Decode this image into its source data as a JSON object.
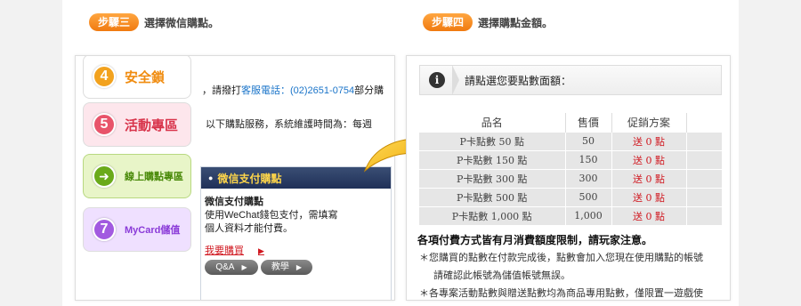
{
  "step3": {
    "badge": "步驟三",
    "text": "選擇微信購點。"
  },
  "step4": {
    "badge": "步驟四",
    "text": "選擇購點金額。"
  },
  "left_menu": [
    {
      "number": "4",
      "label": "安全鎖",
      "color": "#f08c10",
      "circle": "#f2a21e",
      "bg": "#fff"
    },
    {
      "number": "5",
      "label": "活動專區",
      "color": "#d8334a",
      "circle": "#e8546a",
      "bg": "#fde6ec"
    },
    {
      "number": "",
      "label": "線上購點專區",
      "color": "#4a8a0a",
      "circle": "#6aaa1a",
      "bg": "#e8f5c8"
    },
    {
      "number": "7",
      "label": "MyCard儲值",
      "color": "#8a3ad8",
      "circle": "#a25ae0",
      "bg": "#efe0ff"
    }
  ],
  "notice": {
    "line1_prefix": "，請撥打",
    "line1_link": "客服電話：",
    "line1_phone": "(02)2651-0754",
    "line1_suffix": "部分購",
    "line2": "以下購點服務，系統維護時間為：每週"
  },
  "wechat": {
    "header": "微信支付購點",
    "title": "微信支付購點",
    "desc1": "使用WeChat錢包支付，需填寫",
    "desc2": "個人資料才能付費。",
    "buy_link": "我要購買",
    "qa": "Q&A",
    "tutorial": "教學"
  },
  "info_bar": "請點選您要點數面額：",
  "table": {
    "headers": [
      "品名",
      "售價",
      "促銷方案"
    ],
    "rows": [
      [
        "P卡點數 50 點",
        "50",
        "送 0 點"
      ],
      [
        "P卡點數 150 點",
        "150",
        "送 0 點"
      ],
      [
        "P卡點數 300 點",
        "300",
        "送 0 點"
      ],
      [
        "P卡點數 500 點",
        "500",
        "送 0 點"
      ],
      [
        "P卡點數 1,000 點",
        "1,000",
        "送 0 點"
      ]
    ]
  },
  "rules": {
    "title": "各項付費方式皆有月消費額度限制，請玩家注意。",
    "line1": "＊您購買的點數在付款完成後，點數會加入您現在使用購點的帳號",
    "line2": "請確認此帳號為儲值帳號無誤。",
    "line3": "＊各專案活動點數與贈送點數均為商品專用點數，僅限置一遊戲使"
  },
  "colors": {
    "accent": "#f07a10",
    "link": "#1a74c9",
    "promo": "#d0171f",
    "wechat_header": "#1f3058"
  }
}
